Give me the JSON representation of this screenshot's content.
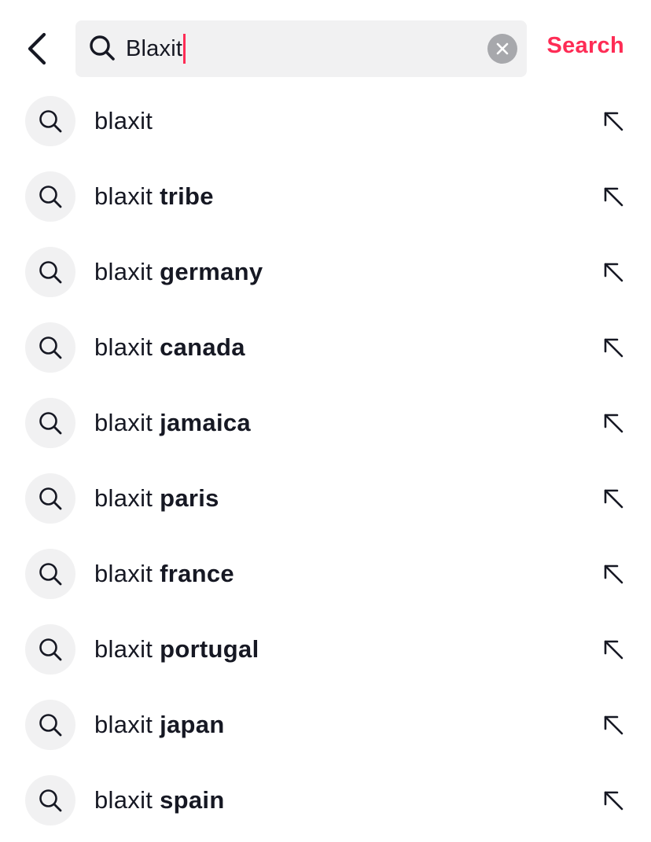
{
  "header": {
    "search_value": "Blaxit",
    "search_button_label": "Search",
    "back_icon": "chevron-left-icon",
    "search_icon": "search-icon",
    "clear_icon": "clear-icon"
  },
  "colors": {
    "accent": "#fe2c55",
    "text": "#161823",
    "field_bg": "#f1f1f2",
    "clear_bg": "#a7a8ac"
  },
  "suggestions": [
    {
      "query": "blaxit",
      "suffix": ""
    },
    {
      "query": "blaxit",
      "suffix": "tribe"
    },
    {
      "query": "blaxit",
      "suffix": "germany"
    },
    {
      "query": "blaxit",
      "suffix": "canada"
    },
    {
      "query": "blaxit",
      "suffix": "jamaica"
    },
    {
      "query": "blaxit",
      "suffix": "paris"
    },
    {
      "query": "blaxit",
      "suffix": "france"
    },
    {
      "query": "blaxit",
      "suffix": "portugal"
    },
    {
      "query": "blaxit",
      "suffix": "japan"
    },
    {
      "query": "blaxit",
      "suffix": "spain"
    }
  ],
  "suggestion_icons": {
    "leading": "search-icon",
    "trailing": "arrow-up-left-icon"
  }
}
